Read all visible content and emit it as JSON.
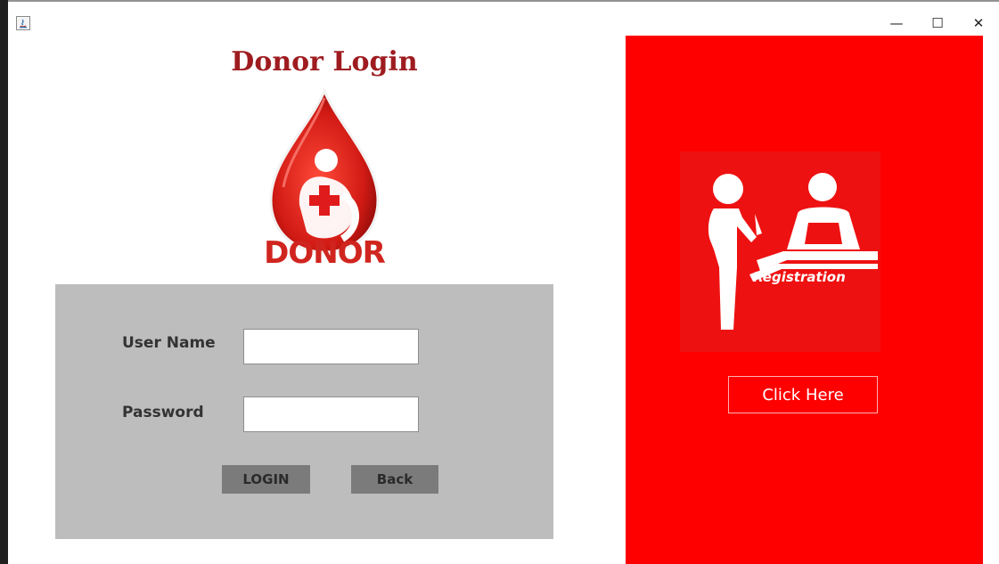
{
  "window": {
    "controls": {
      "minimize": "—",
      "maximize": "☐",
      "close": "✕"
    }
  },
  "login": {
    "title": "Donor Login",
    "logo_text": "DONOR",
    "username_label": "User Name",
    "username_value": "",
    "password_label": "Password",
    "password_value": "",
    "login_button": "LOGIN",
    "back_button": "Back"
  },
  "registration": {
    "image_caption": "Registration",
    "button": "Click Here"
  },
  "colors": {
    "title": "#9e1c20",
    "panel_gray": "#bdbdbd",
    "button_gray": "#7b7b7b",
    "accent_red": "#ff0000"
  },
  "icons": [
    "java-app-icon",
    "blood-drop-logo",
    "registration-icon",
    "minimize-icon",
    "maximize-icon",
    "close-icon"
  ]
}
